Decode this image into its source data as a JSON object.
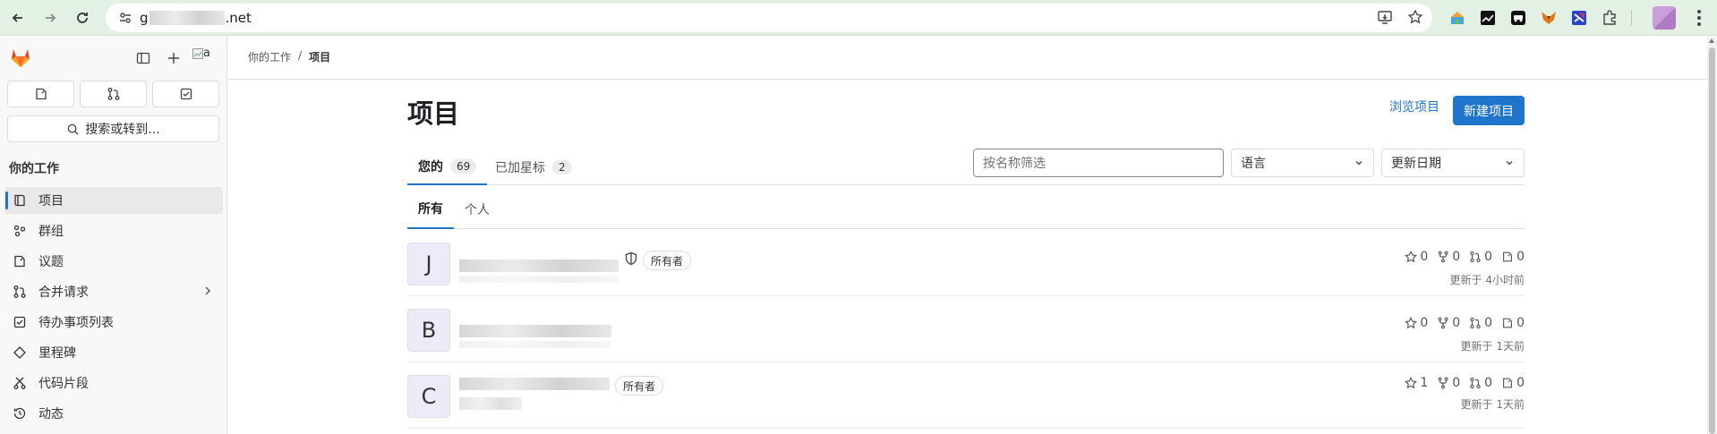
{
  "browser": {
    "url_prefix": "g",
    "url_suffix": ".net"
  },
  "sidebar": {
    "avatar_alt": "a",
    "search_label": "搜索或转到...",
    "section_title": "你的工作",
    "items": [
      {
        "label": "项目",
        "icon": "project-icon",
        "active": true
      },
      {
        "label": "群组",
        "icon": "group-icon"
      },
      {
        "label": "议题",
        "icon": "issues-icon"
      },
      {
        "label": "合并请求",
        "icon": "merge-request-icon",
        "has_children": true
      },
      {
        "label": "待办事项列表",
        "icon": "todo-icon"
      },
      {
        "label": "里程碑",
        "icon": "milestone-icon"
      },
      {
        "label": "代码片段",
        "icon": "snippet-icon"
      },
      {
        "label": "动态",
        "icon": "activity-icon"
      }
    ]
  },
  "breadcrumb": {
    "parent": "你的工作",
    "separator": "/",
    "current": "项目"
  },
  "page": {
    "title": "项目",
    "explore_label": "浏览项目",
    "new_label": "新建项目"
  },
  "tabs": [
    {
      "label": "您的",
      "count": "69",
      "active": true
    },
    {
      "label": "已加星标",
      "count": "2"
    }
  ],
  "filters": {
    "name_placeholder": "按名称筛选",
    "language": "语言",
    "sort": "更新日期"
  },
  "subtabs": [
    {
      "label": "所有",
      "active": true
    },
    {
      "label": "个人"
    }
  ],
  "projects": [
    {
      "letter": "J",
      "role": "所有者",
      "stars": "0",
      "forks": "0",
      "mrs": "0",
      "issues": "0",
      "updated": "更新于 4小时前"
    },
    {
      "letter": "B",
      "role": "",
      "stars": "0",
      "forks": "0",
      "mrs": "0",
      "issues": "0",
      "updated": "更新于 1天前"
    },
    {
      "letter": "C",
      "role": "所有者",
      "stars": "1",
      "forks": "0",
      "mrs": "0",
      "issues": "0",
      "updated": "更新于 1天前"
    }
  ],
  "colors": {
    "accent": "#1f75cb",
    "chrome": "#e3f1e4",
    "avatar_bg": "#eeebf8"
  }
}
